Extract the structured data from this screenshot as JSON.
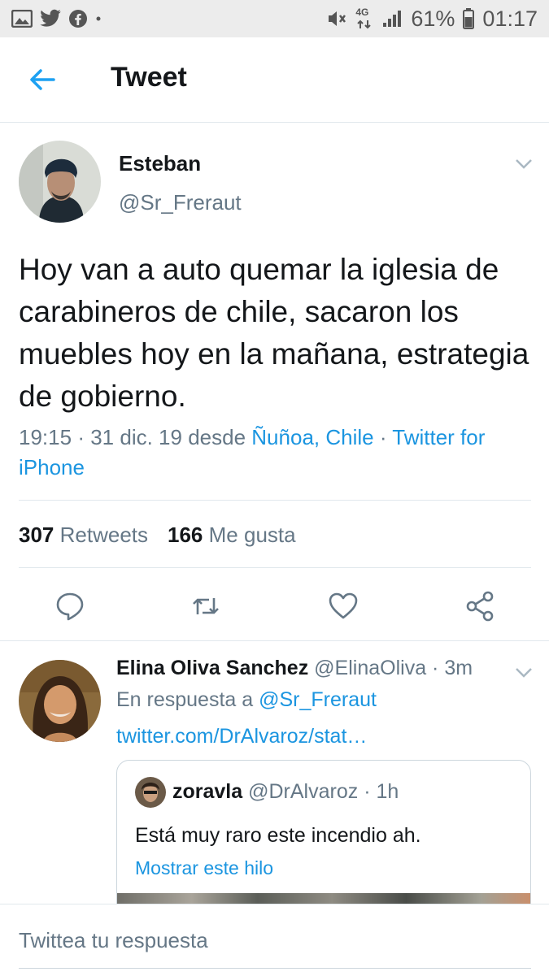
{
  "status_bar": {
    "left_icons": [
      "image-icon",
      "twitter-icon",
      "facebook-icon",
      "dot-icon"
    ],
    "network": "4G",
    "battery": "61%",
    "time": "01:17"
  },
  "header": {
    "back_icon": "arrow-left-icon",
    "title": "Tweet"
  },
  "tweet": {
    "author_name": "Esteban",
    "author_handle": "@Sr_Freraut",
    "text": "Hoy van a auto quemar la iglesia de carabineros de chile, sacaron los muebles hoy en la mañana, estrategia de gobierno.",
    "time": "19:15",
    "date": "31 dic. 19",
    "from_label": "desde",
    "location": "Ñuñoa, Chile",
    "separator": "·",
    "client": "Twitter for iPhone",
    "retweets_count": "307",
    "retweets_label": "Retweets",
    "likes_count": "166",
    "likes_label": "Me gusta",
    "actions": [
      "reply-icon",
      "retweet-icon",
      "like-icon",
      "share-icon"
    ]
  },
  "reply": {
    "name": "Elina Oliva Sanchez",
    "handle": "@ElinaOliva",
    "time": "3m",
    "in_reply_label": "En respuesta a",
    "in_reply_handle": "@Sr_Freraut",
    "link": "twitter.com/DrAlvaroz/stat…",
    "quote": {
      "name": "zoravla",
      "handle": "@DrAlvaroz",
      "time": "1h",
      "text": "Está muy raro este incendio ah.",
      "show_thread": "Mostrar este hilo"
    }
  },
  "compose": {
    "placeholder": "Twittea tu respuesta"
  },
  "colors": {
    "accent": "#1b95e0",
    "secondary_text": "#657786",
    "primary_text": "#14171a",
    "divider": "#e1e8ed"
  }
}
